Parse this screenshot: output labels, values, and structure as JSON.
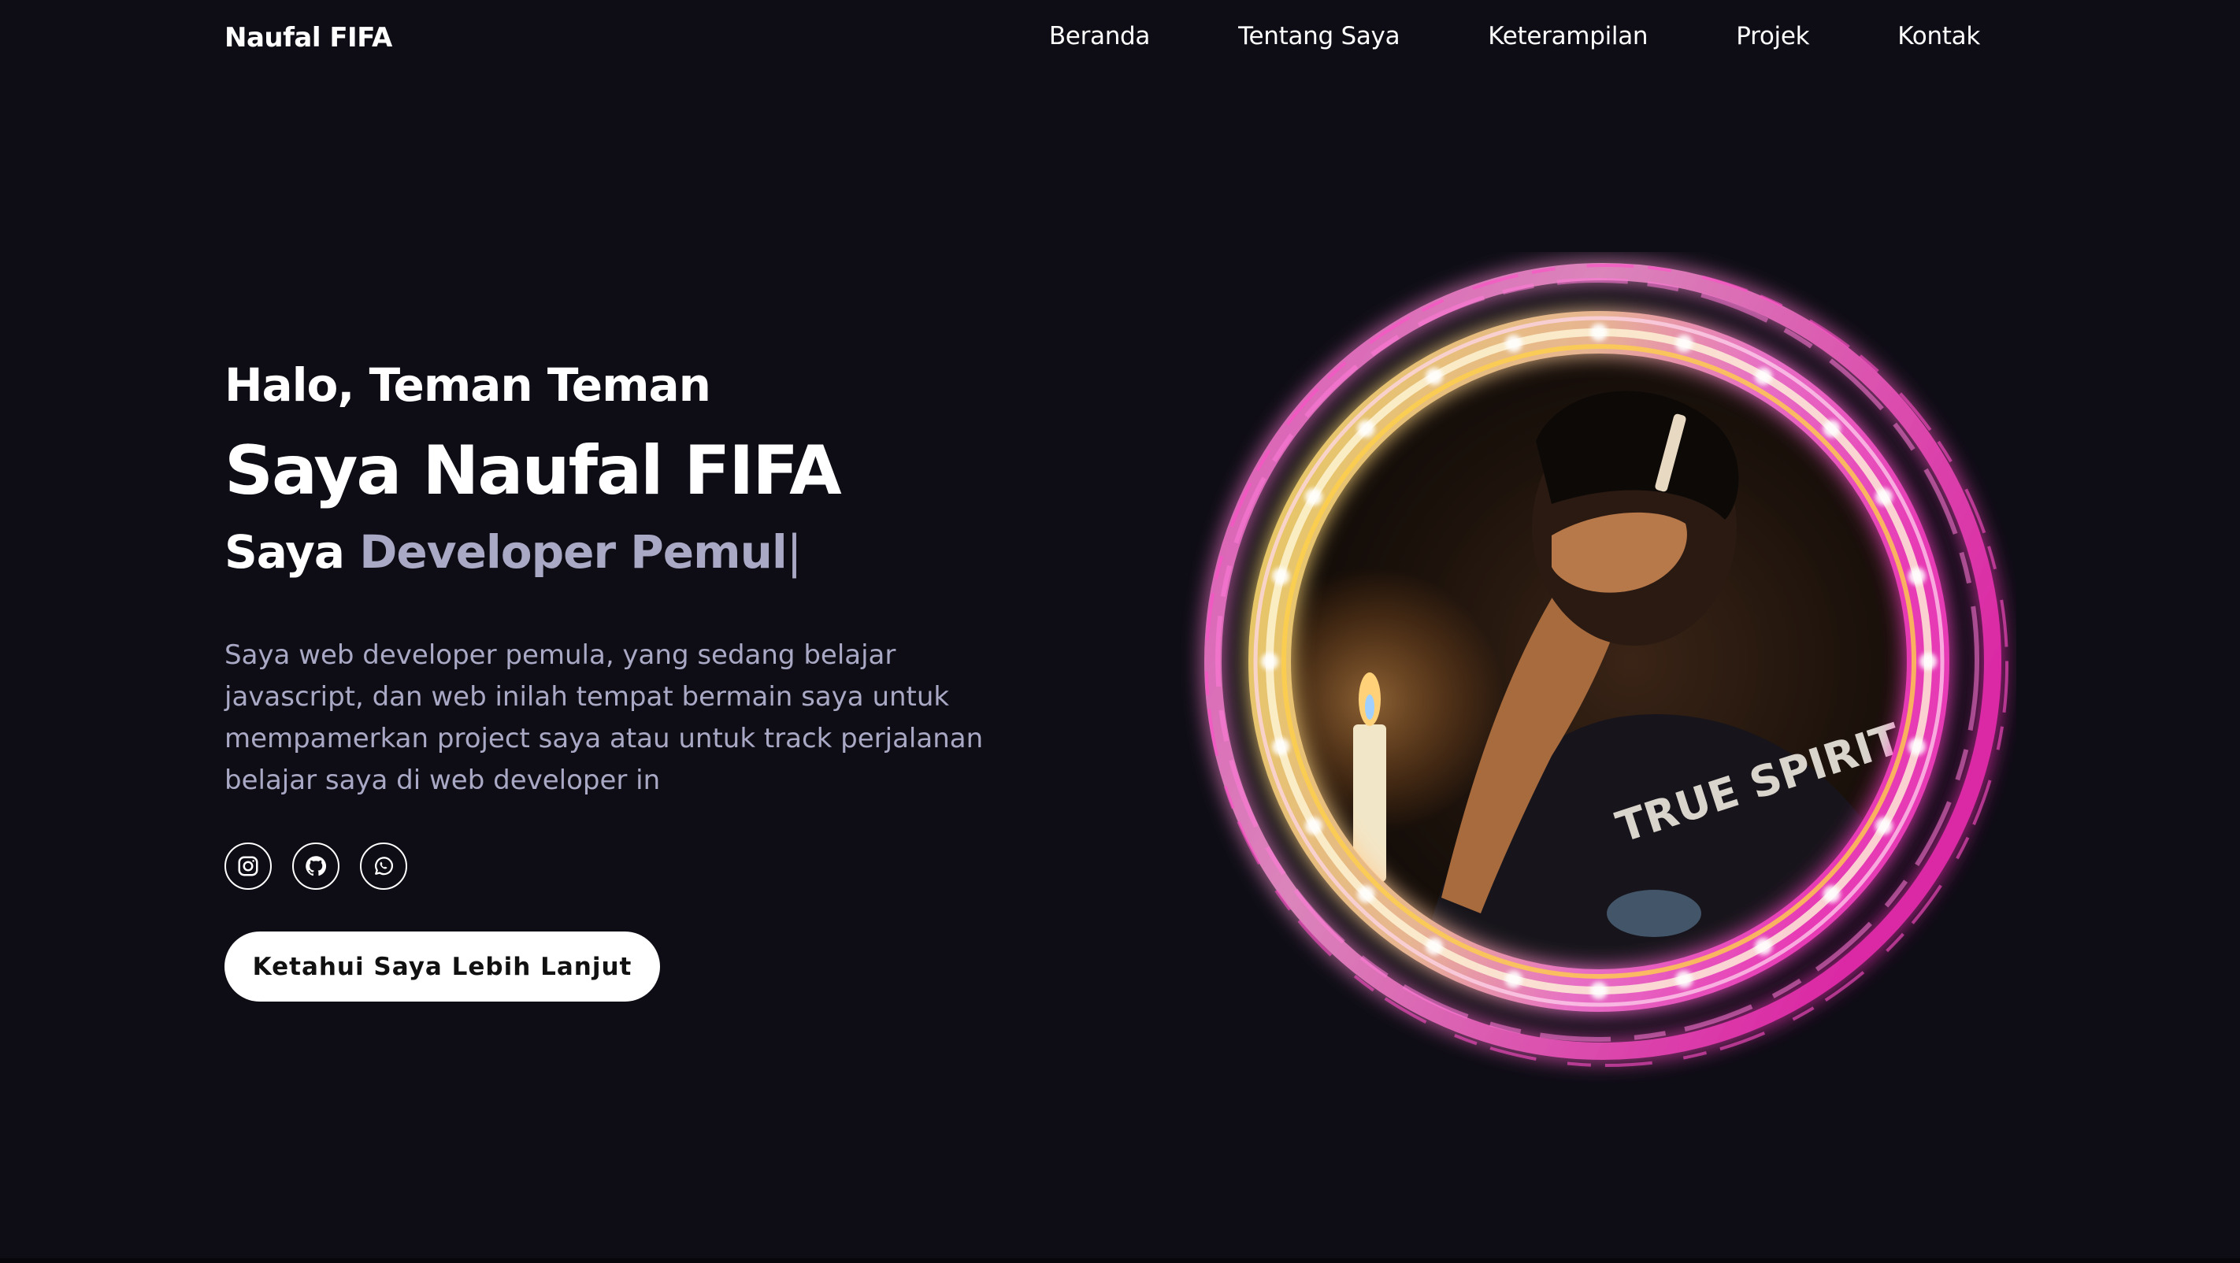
{
  "nav": {
    "logo": "Naufal FIFA",
    "links": [
      "Beranda",
      "Tentang Saya",
      "Keterampilan",
      "Projek",
      "Kontak"
    ]
  },
  "hero": {
    "greeting": "Halo, Teman Teman",
    "name": "Saya Naufal FIFA",
    "role_prefix": "Saya",
    "role_typed": "Developer Pemul",
    "cursor": "|",
    "description": "Saya web developer pemula, yang sedang belajar javascript, dan web inilah tempat bermain saya untuk mempamerkan project saya atau untuk track perjalanan belajar saya di web developer in",
    "cta": "Ketahui Saya Lebih Lanjut"
  },
  "socials": [
    {
      "icon": "instagram-icon"
    },
    {
      "icon": "github-icon"
    },
    {
      "icon": "whatsapp-icon"
    }
  ],
  "portrait": {
    "shirt_text": "TRUE SPIRIT"
  },
  "colors": {
    "background": "#0e0d15",
    "muted_text": "#a9a9c6",
    "ring_yellow": "#ffd84a",
    "ring_pink": "#ff4fd0"
  }
}
